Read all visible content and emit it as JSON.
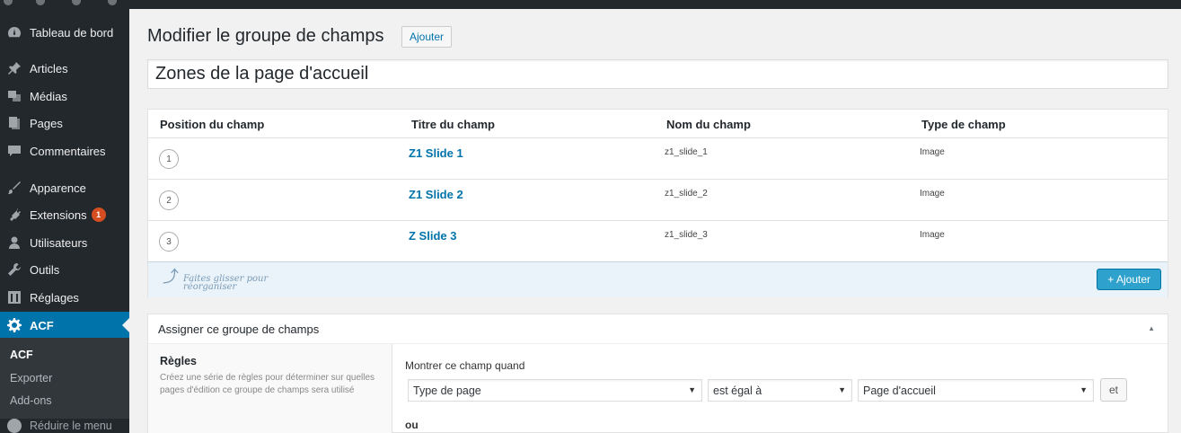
{
  "sidebar": {
    "items": [
      {
        "label": "Tableau de bord",
        "icon": "dashboard-icon"
      },
      {
        "label": "Articles",
        "icon": "pin-icon"
      },
      {
        "label": "Médias",
        "icon": "media-icon"
      },
      {
        "label": "Pages",
        "icon": "pages-icon"
      },
      {
        "label": "Commentaires",
        "icon": "comment-icon"
      },
      {
        "label": "Apparence",
        "icon": "brush-icon"
      },
      {
        "label": "Extensions",
        "icon": "plugin-icon",
        "badge": "1"
      },
      {
        "label": "Utilisateurs",
        "icon": "user-icon"
      },
      {
        "label": "Outils",
        "icon": "wrench-icon"
      },
      {
        "label": "Réglages",
        "icon": "settings-icon"
      },
      {
        "label": "ACF",
        "icon": "gear-icon"
      }
    ],
    "submenu": [
      "ACF",
      "Exporter",
      "Add-ons"
    ],
    "collapse_label": "Réduire le menu"
  },
  "header": {
    "title": "Modifier le groupe de champs",
    "add_label": "Ajouter"
  },
  "group_title": "Zones de la page d'accueil",
  "fields": {
    "columns": [
      "Position du champ",
      "Titre du champ",
      "Nom du champ",
      "Type de champ"
    ],
    "rows": [
      {
        "order": "1",
        "title": "Z1 Slide 1",
        "name": "z1_slide_1",
        "type": "Image"
      },
      {
        "order": "2",
        "title": "Z1 Slide 2",
        "name": "z1_slide_2",
        "type": "Image"
      },
      {
        "order": "3",
        "title": "Z Slide 3",
        "name": "z1_slide_3",
        "type": "Image"
      }
    ],
    "drag_hint": "Faites glisser pour réorganiser",
    "add_button": "+ Ajouter"
  },
  "location": {
    "title": "Assigner ce groupe de champs",
    "rules_label": "Règles",
    "rules_desc": "Créez une série de règles pour déterminer sur quelles pages d'édition ce groupe de champs sera utilisé",
    "show_when": "Montrer ce champ quand",
    "param": "Type de page",
    "operator": "est égal à",
    "value": "Page d'accueil",
    "and_label": "et",
    "or_label": "ou"
  },
  "colors": {
    "sidebar_bg": "#23282d",
    "active": "#0073aa",
    "link": "#0073aa",
    "primary_button": "#2ea2cc",
    "badge": "#d54e21"
  }
}
